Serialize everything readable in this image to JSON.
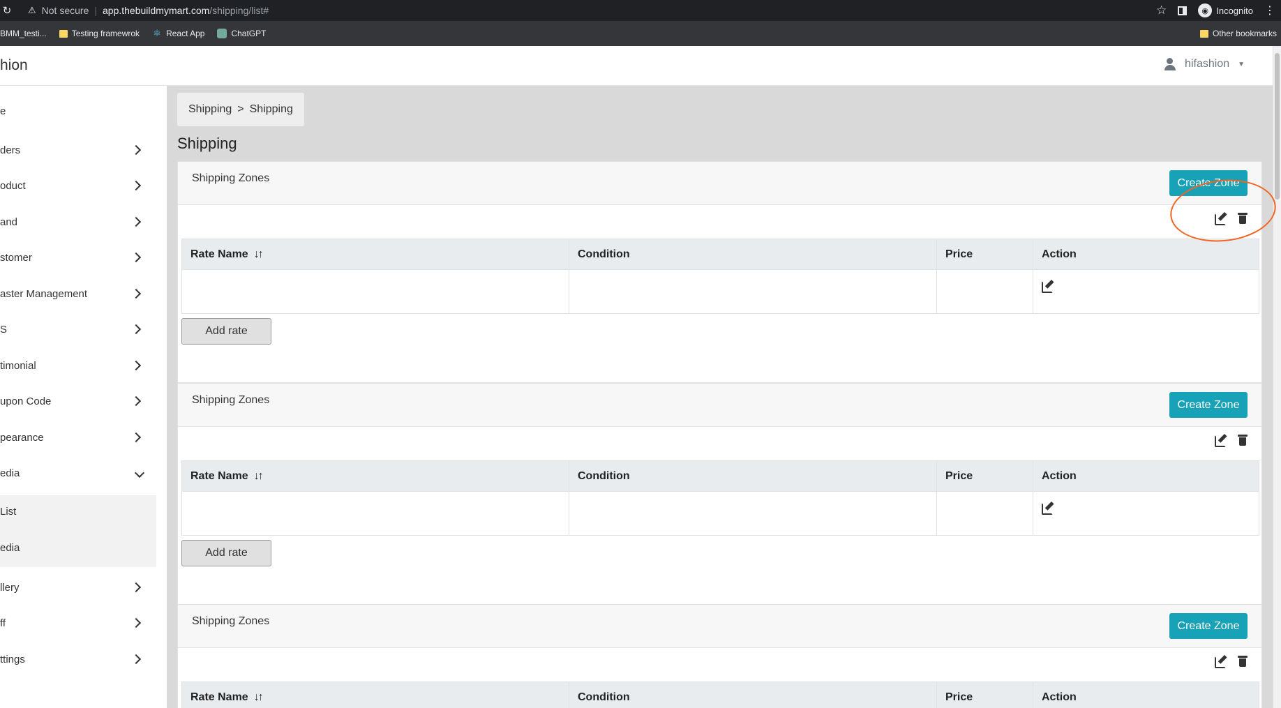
{
  "browser": {
    "security_label": "Not secure",
    "url_host": "app.thebuildmymart.com",
    "url_path": "/shipping/list#",
    "incognito_label": "Incognito",
    "bookmarks": [
      "BMM_testi...",
      "Testing framewrok",
      "React App",
      "ChatGPT"
    ],
    "other_bookmarks": "Other bookmarks"
  },
  "header": {
    "brand": "hion",
    "user": "hifashion"
  },
  "sidebar": {
    "items": [
      {
        "label": "e",
        "chevron": false
      },
      {
        "label": "ders",
        "chevron": true
      },
      {
        "label": "oduct",
        "chevron": true
      },
      {
        "label": "and",
        "chevron": true
      },
      {
        "label": "stomer",
        "chevron": true
      },
      {
        "label": "aster Management",
        "chevron": true
      },
      {
        "label": "S",
        "chevron": true
      },
      {
        "label": "timonial",
        "chevron": true
      },
      {
        "label": "upon Code",
        "chevron": true
      },
      {
        "label": "pearance",
        "chevron": true
      },
      {
        "label": "edia",
        "chevron": "down"
      },
      {
        "label": "llery",
        "chevron": true
      },
      {
        "label": "ff",
        "chevron": true
      },
      {
        "label": "ttings",
        "chevron": true
      }
    ],
    "submenu": [
      "List",
      "edia"
    ]
  },
  "main": {
    "breadcrumb": [
      "Shipping",
      ">",
      "Shipping"
    ],
    "title": "Shipping",
    "zone_title": "Shipping Zones",
    "create_label": "Create Zone",
    "columns": [
      "Rate Name",
      "Condition",
      "Price",
      "Action"
    ],
    "sort_icon": "↓↑",
    "add_rate_label": "Add rate",
    "annotation_color": "#f26522",
    "accent": "#17a2b8"
  }
}
